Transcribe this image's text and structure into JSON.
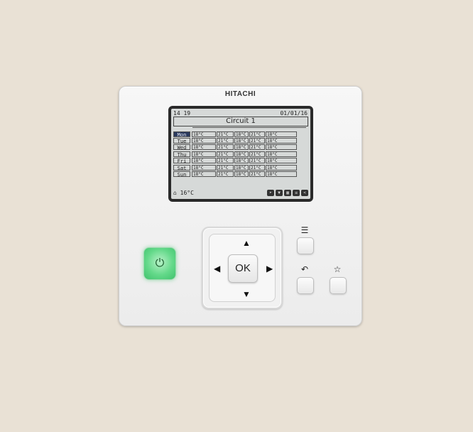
{
  "device": {
    "brand": "HITACHI"
  },
  "screen": {
    "time": "14 19",
    "date": "01/01/16",
    "title": "Circuit 1",
    "room_temp": "16°C",
    "schedule": [
      {
        "day": "Mon",
        "selected": true,
        "cells": [
          "18°C",
          "21°C",
          "18°C",
          "21°C",
          "18°C"
        ]
      },
      {
        "day": "Tue",
        "selected": false,
        "cells": [
          "18°C",
          "21°C",
          "18°C",
          "21°C",
          "18°C"
        ]
      },
      {
        "day": "Wed",
        "selected": false,
        "cells": [
          "18°C",
          "21°C",
          "18°C",
          "21°C",
          "18°C"
        ]
      },
      {
        "day": "Thu",
        "selected": false,
        "cells": [
          "18°C",
          "21°C",
          "18°C",
          "21°C",
          "18°C"
        ]
      },
      {
        "day": "Fri",
        "selected": false,
        "cells": [
          "18°C",
          "21°C",
          "18°C",
          "21°C",
          "18°C"
        ]
      },
      {
        "day": "Sat",
        "selected": false,
        "cells": [
          "18°C",
          "21°C",
          "18°C",
          "21°C",
          "18°C"
        ]
      },
      {
        "day": "Sun",
        "selected": false,
        "cells": [
          "18°C",
          "21°C",
          "18°C",
          "21°C",
          "18°C"
        ]
      }
    ],
    "status_icons": [
      "arrow-icon",
      "down-icon",
      "chart-icon",
      "list-icon",
      "share-icon"
    ]
  },
  "buttons": {
    "ok_label": "OK",
    "power_icon": "⏻",
    "menu_icon": "☰",
    "back_icon": "↶",
    "favorite_icon": "☆",
    "up": "▲",
    "down": "▼",
    "left": "◀",
    "right": "▶"
  },
  "colors": {
    "power_green": "#4fcf7a",
    "lcd_background": "#d6d9d8",
    "selected_day": "#2b3a5e"
  }
}
